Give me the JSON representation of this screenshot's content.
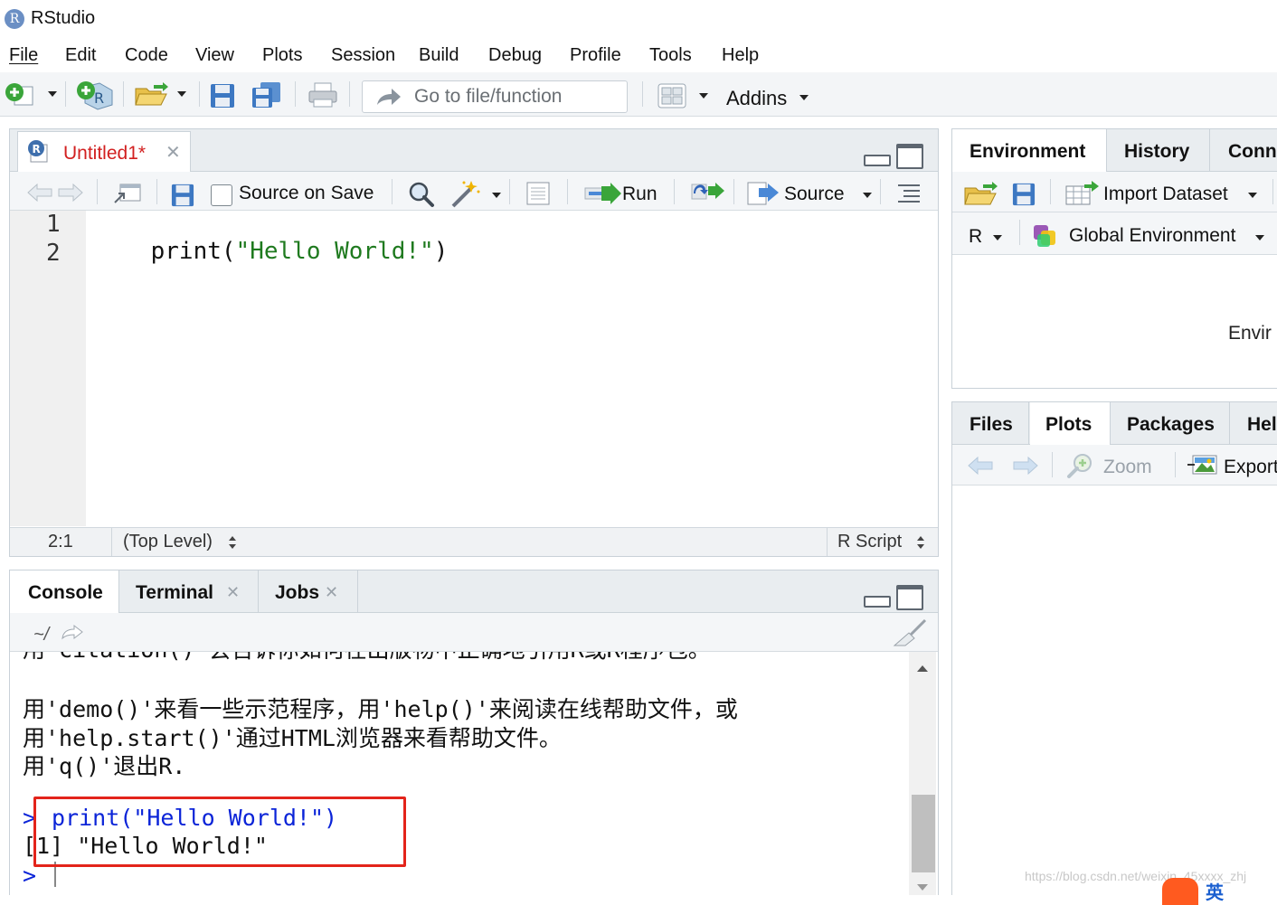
{
  "app": {
    "title": "RStudio",
    "logo_letter": "R"
  },
  "menu": [
    "File",
    "Edit",
    "Code",
    "View",
    "Plots",
    "Session",
    "Build",
    "Debug",
    "Profile",
    "Tools",
    "Help"
  ],
  "toolbar": {
    "goto_placeholder": "Go to file/function",
    "addins_label": "Addins"
  },
  "editor": {
    "tab_title": "Untitled1*",
    "source_on_save": "Source on Save",
    "run_label": "Run",
    "source_label": "Source",
    "line_numbers": [
      "1",
      "2"
    ],
    "code_fn": "print(",
    "code_str": "\"Hello World!\"",
    "code_close": ")",
    "status_position": "2:1",
    "status_scope": "(Top Level)",
    "status_type": "R Script"
  },
  "console_tabs": [
    "Console",
    "Terminal",
    "Jobs"
  ],
  "console": {
    "path": "~/",
    "line_cut": "用'citation()'会告诉你如何在出版物中正确地引用R或R程序包。",
    "line1": "用'demo()'来看一些示范程序，用'help()'来阅读在线帮助文件，或",
    "line2": "用'help.start()'通过HTML浏览器来看帮助文件。",
    "line3": "用'q()'退出R.",
    "prompt": ">",
    "command": "print(\"Hello World!\")",
    "output": "[1] \"Hello World!\""
  },
  "env_tabs": [
    "Environment",
    "History",
    "Conn"
  ],
  "env_toolbar": {
    "import_label": "Import Dataset",
    "lang": "R",
    "scope": "Global Environment"
  },
  "env_body_text": "Envir",
  "files_tabs": [
    "Files",
    "Plots",
    "Packages",
    "Hel"
  ],
  "files_toolbar": {
    "zoom": "Zoom",
    "export": "Export"
  },
  "watermark": "https://blog.csdn.net/weixin_45xxxx_zhj",
  "ime": "英",
  "colors": {
    "accent_green": "#3aa53a",
    "string_green": "#1f7a1f",
    "console_blue": "#0b24d8",
    "highlight_red": "#e3241b",
    "tab_red": "#d22020"
  }
}
